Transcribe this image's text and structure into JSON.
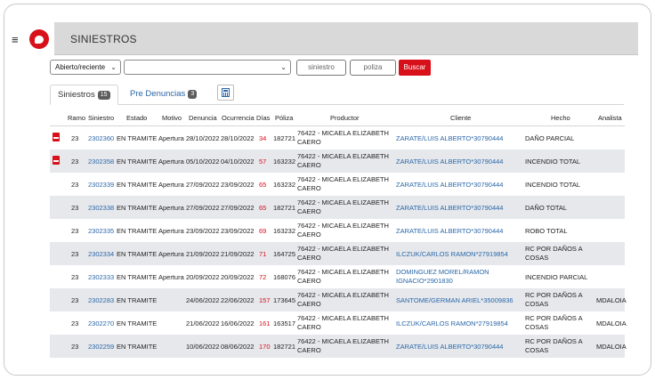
{
  "header": {
    "title": "SINIESTROS",
    "menu_icon": "≡"
  },
  "filters": {
    "estado": "Abierto/reciente",
    "tipo": "",
    "siniestro_placeholder": "siniestro",
    "poliza_placeholder": "poliza",
    "buscar_label": "Buscar"
  },
  "tabs": {
    "siniestros_label": "Siniestros",
    "siniestros_count": "15",
    "pre_label": "Pre Denuncias",
    "pre_count": "3"
  },
  "columns": [
    "Ramo",
    "Siniestro",
    "Estado",
    "Motivo",
    "Denuncia",
    "Ocurrencia",
    "Días",
    "Póliza",
    "Productor",
    "Cliente",
    "Hecho",
    "Analista"
  ],
  "rows": [
    {
      "pdf": true,
      "ramo": "23",
      "siniestro": "2302360",
      "estado": "EN TRAMITE",
      "motivo": "Apertura",
      "denuncia": "28/10/2022",
      "ocurrencia": "28/10/2022",
      "dias": "34",
      "poliza": "182721",
      "productor1": "76422 - MICAELA ELIZABETH",
      "productor2": "CAERO",
      "cliente1": "ZARATE/LUIS ALBERTO*30790444",
      "cliente2": "",
      "hecho1": "DAÑO PARCIAL",
      "hecho2": "",
      "analista": ""
    },
    {
      "pdf": true,
      "ramo": "23",
      "siniestro": "2302358",
      "estado": "EN TRAMITE",
      "motivo": "Apertura",
      "denuncia": "05/10/2022",
      "ocurrencia": "04/10/2022",
      "dias": "57",
      "poliza": "163232",
      "productor1": "76422 - MICAELA ELIZABETH",
      "productor2": "CAERO",
      "cliente1": "ZARATE/LUIS ALBERTO*30790444",
      "cliente2": "",
      "hecho1": "INCENDIO TOTAL",
      "hecho2": "",
      "analista": ""
    },
    {
      "pdf": false,
      "ramo": "23",
      "siniestro": "2302339",
      "estado": "EN TRAMITE",
      "motivo": "Apertura",
      "denuncia": "27/09/2022",
      "ocurrencia": "23/09/2022",
      "dias": "65",
      "poliza": "163232",
      "productor1": "76422 - MICAELA ELIZABETH",
      "productor2": "CAERO",
      "cliente1": "ZARATE/LUIS ALBERTO*30790444",
      "cliente2": "",
      "hecho1": "INCENDIO TOTAL",
      "hecho2": "",
      "analista": ""
    },
    {
      "pdf": false,
      "ramo": "23",
      "siniestro": "2302338",
      "estado": "EN TRAMITE",
      "motivo": "Apertura",
      "denuncia": "27/09/2022",
      "ocurrencia": "27/09/2022",
      "dias": "65",
      "poliza": "182721",
      "productor1": "76422 - MICAELA ELIZABETH",
      "productor2": "CAERO",
      "cliente1": "ZARATE/LUIS ALBERTO*30790444",
      "cliente2": "",
      "hecho1": "DAÑO TOTAL",
      "hecho2": "",
      "analista": ""
    },
    {
      "pdf": false,
      "ramo": "23",
      "siniestro": "2302335",
      "estado": "EN TRAMITE",
      "motivo": "Apertura",
      "denuncia": "23/09/2022",
      "ocurrencia": "23/09/2022",
      "dias": "69",
      "poliza": "163232",
      "productor1": "76422 - MICAELA ELIZABETH",
      "productor2": "CAERO",
      "cliente1": "ZARATE/LUIS ALBERTO*30790444",
      "cliente2": "",
      "hecho1": "ROBO TOTAL",
      "hecho2": "",
      "analista": ""
    },
    {
      "pdf": false,
      "ramo": "23",
      "siniestro": "2302334",
      "estado": "EN TRAMITE",
      "motivo": "Apertura",
      "denuncia": "21/09/2022",
      "ocurrencia": "21/09/2022",
      "dias": "71",
      "poliza": "164725",
      "productor1": "76422 - MICAELA ELIZABETH",
      "productor2": "CAERO",
      "cliente1": "ILCZUK/CARLOS RAMON*27919854",
      "cliente2": "",
      "hecho1": "RC POR DAÑOS A",
      "hecho2": "COSAS",
      "analista": ""
    },
    {
      "pdf": false,
      "ramo": "23",
      "siniestro": "2302333",
      "estado": "EN TRAMITE",
      "motivo": "Apertura",
      "denuncia": "20/09/2022",
      "ocurrencia": "20/09/2022",
      "dias": "72",
      "poliza": "168076",
      "productor1": "76422 - MICAELA ELIZABETH",
      "productor2": "CAERO",
      "cliente1": "DOMINGUEZ MOREL/RAMON",
      "cliente2": "IGNACIO*2901830",
      "hecho1": "INCENDIO PARCIAL",
      "hecho2": "",
      "analista": ""
    },
    {
      "pdf": false,
      "ramo": "23",
      "siniestro": "2302283",
      "estado": "EN TRAMITE",
      "motivo": "",
      "denuncia": "24/06/2022",
      "ocurrencia": "22/06/2022",
      "dias": "157",
      "poliza": "173645",
      "productor1": "76422 - MICAELA ELIZABETH",
      "productor2": "CAERO",
      "cliente1": "SANTOME/GERMAN ARIEL*35009836",
      "cliente2": "",
      "hecho1": "RC POR DAÑOS A",
      "hecho2": "COSAS",
      "analista": "MDALOIA"
    },
    {
      "pdf": false,
      "ramo": "23",
      "siniestro": "2302270",
      "estado": "EN TRAMITE",
      "motivo": "",
      "denuncia": "21/06/2022",
      "ocurrencia": "16/06/2022",
      "dias": "161",
      "poliza": "163517",
      "productor1": "76422 - MICAELA ELIZABETH",
      "productor2": "CAERO",
      "cliente1": "ILCZUK/CARLOS RAMON*27919854",
      "cliente2": "",
      "hecho1": "RC POR DAÑOS A",
      "hecho2": "COSAS",
      "analista": "MDALOIA"
    },
    {
      "pdf": false,
      "ramo": "23",
      "siniestro": "2302259",
      "estado": "EN TRAMITE",
      "motivo": "",
      "denuncia": "10/06/2022",
      "ocurrencia": "08/06/2022",
      "dias": "170",
      "poliza": "182721",
      "productor1": "76422 - MICAELA ELIZABETH",
      "productor2": "CAERO",
      "cliente1": "ZARATE/LUIS ALBERTO*30790444",
      "cliente2": "",
      "hecho1": "RC POR DAÑOS A",
      "hecho2": "COSAS",
      "analista": "MDALOIA"
    }
  ],
  "colors": {
    "accent": "#d7101a",
    "link": "#2a67a8",
    "row_shade": "#e6e8ec",
    "topbar": "#d9d9d9"
  }
}
